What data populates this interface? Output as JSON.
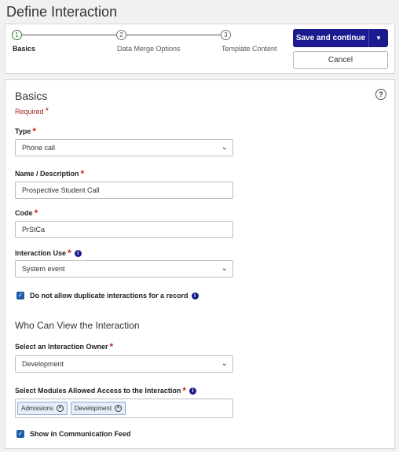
{
  "page": {
    "title": "Define Interaction"
  },
  "wizard": {
    "steps": [
      {
        "number": "1",
        "label": "Basics"
      },
      {
        "number": "2",
        "label": "Data Merge Options"
      },
      {
        "number": "3",
        "label": "Template Content"
      }
    ],
    "save_label": "Save and continue",
    "cancel_label": "Cancel"
  },
  "basics": {
    "title": "Basics",
    "required_label": "Required",
    "help_label": "?",
    "type": {
      "label": "Type",
      "value": "Phone call"
    },
    "name": {
      "label": "Name / Description",
      "value": "Prospective Student Call"
    },
    "code": {
      "label": "Code",
      "value": "PrStCa"
    },
    "use": {
      "label": "Interaction Use",
      "value": "System event"
    },
    "no_duplicates": {
      "label": "Do not allow duplicate interactions for a record",
      "checked": true
    }
  },
  "who": {
    "title": "Who Can View the Interaction",
    "owner": {
      "label": "Select an Interaction Owner",
      "value": "Development"
    },
    "modules": {
      "label": "Select Modules Allowed Access to the Interaction",
      "tags": [
        "Admissions",
        "Development"
      ]
    },
    "show_feed": {
      "label": "Show in Communication Feed",
      "checked": true
    }
  },
  "colors": {
    "primary": "#1b1b8f",
    "required": "#c62828",
    "checkbox": "#1b5fa6"
  }
}
